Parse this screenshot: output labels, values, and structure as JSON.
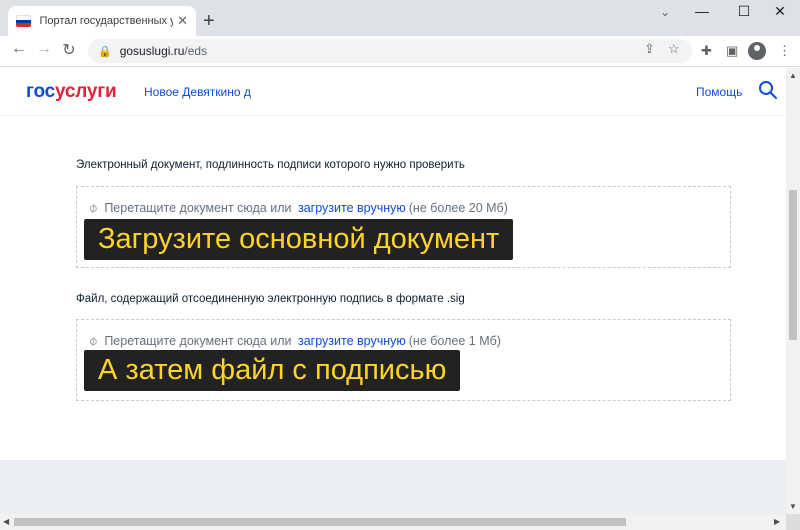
{
  "browser": {
    "tab_title": "Портал государственных услуг Р",
    "tab_close": "✕",
    "new_tab": "+",
    "window_controls": {
      "minimize": "—",
      "maximize": "☐",
      "close": "✕"
    },
    "tab_search": "⌄",
    "url_host": "gosuslugi.ru",
    "url_path": "/eds",
    "nav": {
      "back": "←",
      "forward": "→",
      "reload": "↻"
    },
    "lock_icon": "🔒",
    "share_icon": "⇪",
    "star_icon": "☆",
    "extensions_icon": "✚",
    "sidepanel_icon": "▣",
    "menu_icon": "⋮"
  },
  "site": {
    "logo_part1": "гос",
    "logo_part2": "услуги",
    "region": "Новое Девяткино д",
    "help": "Помощь",
    "brand_blue": "#0d4cd3",
    "brand_red": "#e4213a"
  },
  "sections": [
    {
      "title": "Электронный документ, подлинность подписи которого нужно проверить",
      "drop_text": "Перетащите документ сюда или",
      "upload_link": "загрузите вручную",
      "limit": "(не более 20 Мб)"
    },
    {
      "title": "Файл, содержащий отсоединенную электронную подпись в формате .sig",
      "drop_text": "Перетащите документ сюда или",
      "upload_link": "загрузите вручную",
      "limit": "(не более 1 Мб)"
    }
  ],
  "overlays": {
    "first": "Загрузите основной документ",
    "second": "А затем файл с подписью",
    "text_color": "#ffd42a"
  },
  "scrollbar": {
    "up": "▲",
    "down": "▼",
    "left": "◀",
    "right": "▶"
  }
}
